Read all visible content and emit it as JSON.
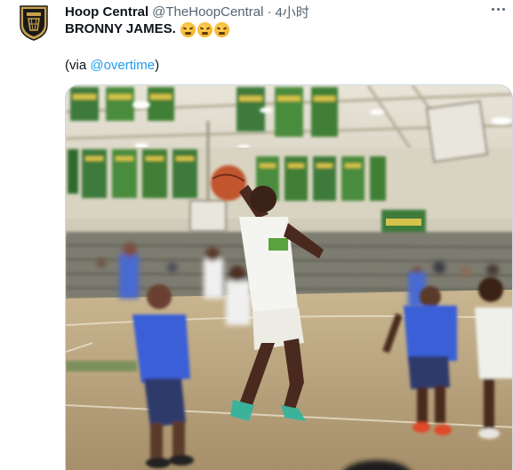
{
  "tweet": {
    "author_name": "Hoop Central",
    "author_handle": "@TheHoopCentral",
    "separator": "·",
    "timestamp": "4小时",
    "text": "BRONNY JAMES.",
    "emoji_name": "face-with-steam-from-nose",
    "emoji_count": 3,
    "via_open": "(via ",
    "via_link": "@overtime",
    "via_close": ")",
    "avatar_icon": "hoop-central-crest-icon",
    "more_icon": "more-options-icon"
  },
  "media": {
    "type": "video",
    "description_icon": "basketball-dunk-video"
  },
  "colors": {
    "link": "#1d9bf0",
    "text": "#0f1419",
    "secondary": "#536471"
  }
}
